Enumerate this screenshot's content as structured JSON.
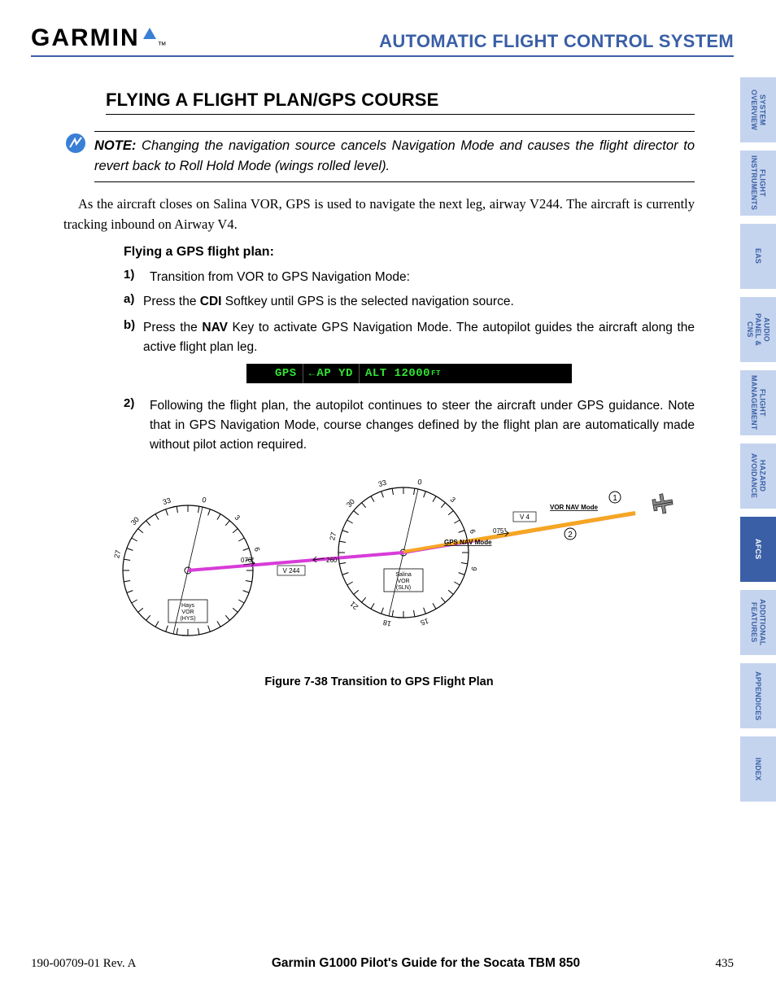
{
  "header": {
    "logo_text": "GARMIN",
    "title": "AUTOMATIC FLIGHT CONTROL SYSTEM"
  },
  "tabs": [
    {
      "label": "SYSTEM OVERVIEW",
      "active": false
    },
    {
      "label": "FLIGHT INSTRUMENTS",
      "active": false
    },
    {
      "label": "EAS",
      "active": false
    },
    {
      "label": "AUDIO PANEL & CNS",
      "active": false
    },
    {
      "label": "FLIGHT MANAGEMENT",
      "active": false
    },
    {
      "label": "HAZARD AVOIDANCE",
      "active": false
    },
    {
      "label": "AFCS",
      "active": true
    },
    {
      "label": "ADDITIONAL FEATURES",
      "active": false
    },
    {
      "label": "APPENDICES",
      "active": false
    },
    {
      "label": "INDEX",
      "active": false
    }
  ],
  "section": {
    "title": "FLYING A FLIGHT PLAN/GPS COURSE",
    "note_label": "NOTE:",
    "note_body": "Changing the navigation source cancels Navigation Mode and causes the flight director to revert back to Roll Hold Mode (wings rolled level).",
    "para1": "As the aircraft closes on Salina VOR, GPS is used to navigate the next leg, airway V244.  The aircraft is currently tracking inbound on Airway V4.",
    "subhead": "Flying a GPS flight plan:",
    "step1_num": "1)",
    "step1_body": "Transition from VOR to GPS Navigation Mode:",
    "step1a_letter": "a)",
    "step1a_pre": "Press the ",
    "step1a_bold": "CDI",
    "step1a_post": " Softkey until GPS is the selected navigation source.",
    "step1b_letter": "b)",
    "step1b_pre": "Press the ",
    "step1b_bold": "NAV",
    "step1b_post": " Key to activate GPS Navigation Mode.  The autopilot guides the aircraft along the active flight plan leg.",
    "status": {
      "lateral": "GPS",
      "ap": "AP YD",
      "vertical": "ALT",
      "value": "12000",
      "unit": "FT"
    },
    "step2_num": "2)",
    "step2_body": "Following the flight plan, the autopilot continues to steer the aircraft under GPS guidance.  Note that in GPS Navigation Mode, course changes defined by the flight plan are automatically made without pilot action required.",
    "figure": {
      "caption": "Figure 7-38  Transition to GPS Flight Plan",
      "vor1_name": "Hays VOR (HYS)",
      "vor2_name": "Salina VOR (SLN)",
      "airway1": "V 244",
      "airway2": "V 4",
      "course1": "076°",
      "course1b": "260°",
      "course2": "075°",
      "mode_label1": "GPS NAV Mode",
      "mode_label2": "VOR NAV Mode",
      "marker1": "1",
      "marker2": "2"
    }
  },
  "footer": {
    "left": "190-00709-01  Rev. A",
    "center": "Garmin G1000 Pilot's Guide for the Socata TBM 850",
    "page": "435"
  }
}
